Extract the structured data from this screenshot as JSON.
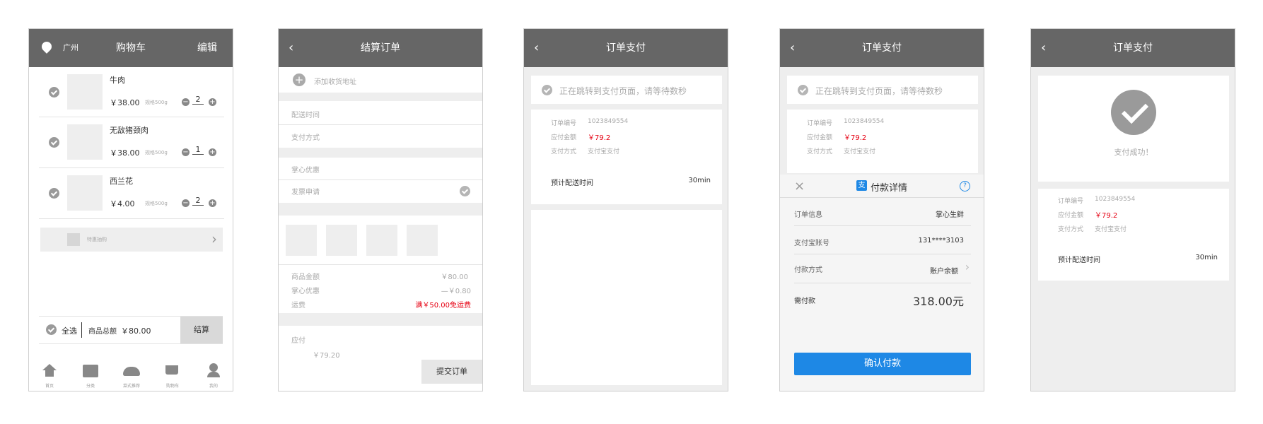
{
  "s1": {
    "city": "广州",
    "title": "购物车",
    "edit": "编辑",
    "items": [
      {
        "name": "牛肉",
        "price": "￥38.00",
        "spec": "规格500g",
        "qty": "2"
      },
      {
        "name": "无敌猪颈肉",
        "price": "￥38.00",
        "spec": "规格500g",
        "qty": "1"
      },
      {
        "name": "西兰花",
        "price": "￥4.00",
        "spec": "规格500g",
        "qty": "2"
      }
    ],
    "promo": "特惠抽购",
    "select_all": "全选",
    "total_label": "商品总额",
    "total_value": "￥80.00",
    "checkout": "结算",
    "tabs": [
      "首页",
      "分类",
      "菜式推荐",
      "购物车",
      "我的"
    ]
  },
  "s2": {
    "title": "结算订单",
    "add_address": "添加收货地址",
    "delivery_time": "配送时间",
    "pay_method": "支付方式",
    "discount": "掌心优惠",
    "invoice": "发票申请",
    "goods_amount_label": "商品金额",
    "goods_amount": "￥80.00",
    "discount_label": "掌心优惠",
    "discount_value": "—￥0.80",
    "shipping_label": "运费",
    "shipping_value": "满￥50.00免运费",
    "payable_label": "应付",
    "payable_value": "￥79.20",
    "submit": "提交订单"
  },
  "s3": {
    "title": "订单支付",
    "redirect": "正在跳转到支付页面，请等待数秒",
    "order_no_label": "订单编号",
    "order_no": "1023849554",
    "amount_label": "应付金额",
    "amount": "￥79.2",
    "method_label": "支付方式",
    "method": "支付宝支付",
    "eta_label": "预计配送时间",
    "eta": "30min"
  },
  "s4": {
    "title": "订单支付",
    "redirect": "正在跳转到支付页面，请等待数秒",
    "order_no_label": "订单编号",
    "order_no": "1023849554",
    "amount_label": "应付金额",
    "amount": "￥79.2",
    "method_label": "支付方式",
    "method": "支付宝支付",
    "sheet_title": "付款详情",
    "close": "×",
    "help": "?",
    "alipay_glyph": "支",
    "order_info_label": "订单信息",
    "order_info": "掌心生鲜",
    "account_label": "支付宝账号",
    "account": "131****3103",
    "pay_way_label": "付款方式",
    "pay_way": "账户余额",
    "need_pay_label": "需付款",
    "need_pay": "318.00元",
    "confirm": "确认付款"
  },
  "s5": {
    "title": "订单支付",
    "success": "支付成功！",
    "order_no_label": "订单编号",
    "order_no": "1023849554",
    "amount_label": "应付金额",
    "amount": "￥79.2",
    "method_label": "支付方式",
    "method": "支付宝支付",
    "eta_label": "预计配送时间",
    "eta": "30min"
  },
  "colors": {
    "header": "#666666",
    "accent_blue": "#1e88e5",
    "price_red": "#e60012",
    "band": "#eeeeee"
  }
}
